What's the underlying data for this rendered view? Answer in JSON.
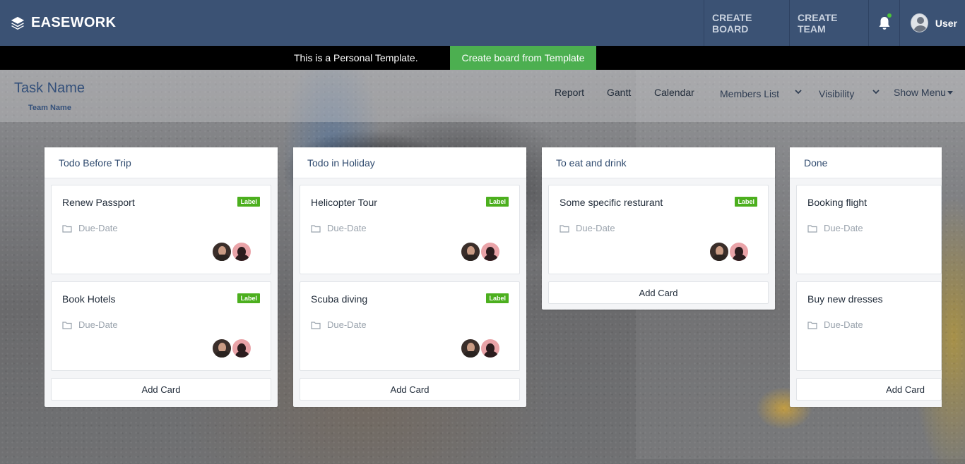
{
  "navbar": {
    "brand": "EASEWORK",
    "create_board": "CREATE BOARD",
    "create_team": "CREATE TEAM",
    "user": "User"
  },
  "template_bar": {
    "message": "This is a Personal Template.",
    "button": "Create board from Template"
  },
  "board": {
    "title": "Task Name",
    "team": "Team Name",
    "menu": {
      "report": "Report",
      "gantt": "Gantt",
      "calendar": "Calendar",
      "members": "Members List",
      "visibility": "Visibility",
      "show_menu": "Show Menu"
    }
  },
  "columns": [
    {
      "title": "Todo Before Trip",
      "cards": [
        {
          "title": "Renew Passport",
          "label": "Label",
          "due": "Due-Date"
        },
        {
          "title": "Book Hotels",
          "label": "Label",
          "due": "Due-Date"
        }
      ],
      "add": "Add Card"
    },
    {
      "title": "Todo in Holiday",
      "cards": [
        {
          "title": "Helicopter Tour",
          "label": "Label",
          "due": "Due-Date"
        },
        {
          "title": "Scuba diving",
          "label": "Label",
          "due": "Due-Date"
        }
      ],
      "add": "Add Card"
    },
    {
      "title": "To eat and drink",
      "cards": [
        {
          "title": "Some specific resturant",
          "label": "Label",
          "due": "Due-Date"
        }
      ],
      "add": "Add Card"
    },
    {
      "title": "Done",
      "cards": [
        {
          "title": "Booking flight",
          "due": "Due-Date"
        },
        {
          "title": "Buy new dresses",
          "due": "Due-Date"
        }
      ],
      "add": "Add Card"
    }
  ],
  "colors": {
    "navbar": "#3b5274",
    "accent_green": "#4caf50",
    "label_green": "#4caf1e",
    "notification_dot": "#4cc33b"
  }
}
